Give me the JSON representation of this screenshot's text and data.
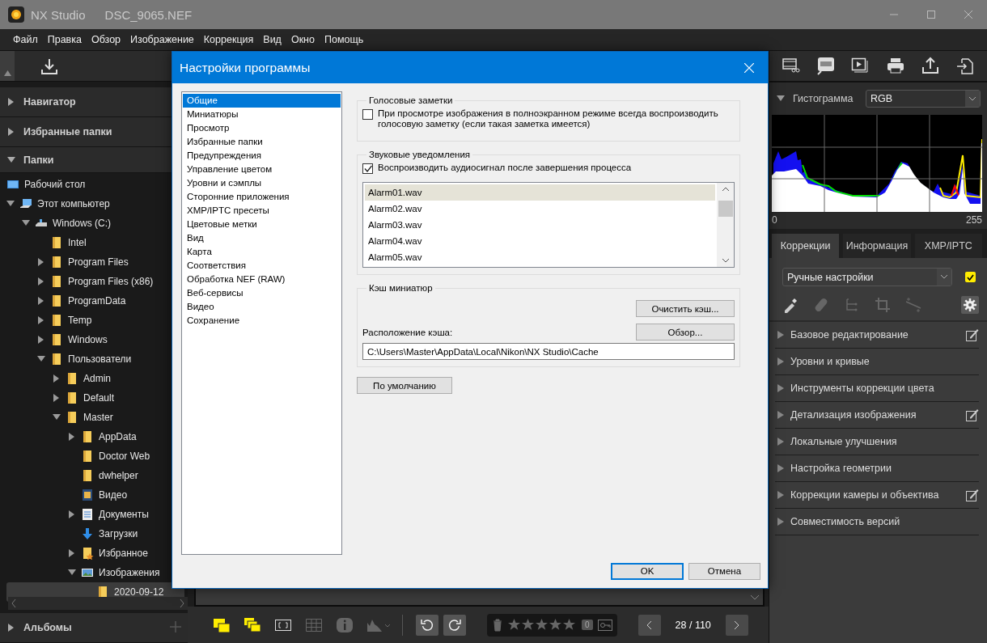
{
  "app_title": {
    "name": "NX Studio",
    "file": "DSC_9065.NEF"
  },
  "menu": [
    "Файл",
    "Правка",
    "Обзор",
    "Изображение",
    "Коррекция",
    "Вид",
    "Окно",
    "Помощь"
  ],
  "left_panel": {
    "sections": [
      {
        "label": "Навигатор",
        "expanded": false
      },
      {
        "label": "Избранные папки",
        "expanded": false
      },
      {
        "label": "Папки",
        "expanded": true
      }
    ],
    "tree": [
      {
        "label": "Рабочий стол",
        "kind": "desktop",
        "selected": false
      },
      {
        "label": "Этот компьютер",
        "kind": "computer",
        "expanded": true,
        "selected": false,
        "children": [
          {
            "label": "Windows (C:)",
            "kind": "drive",
            "expanded": true,
            "selected": false,
            "children": [
              {
                "label": "Intel",
                "kind": "folder",
                "selected": false
              },
              {
                "label": "Program Files",
                "kind": "folder",
                "expanded": false,
                "selected": false
              },
              {
                "label": "Program Files (x86)",
                "kind": "folder",
                "expanded": false,
                "selected": false
              },
              {
                "label": "ProgramData",
                "kind": "folder",
                "expanded": false,
                "selected": false
              },
              {
                "label": "Temp",
                "kind": "folder",
                "expanded": false,
                "selected": false
              },
              {
                "label": "Windows",
                "kind": "folder",
                "expanded": false,
                "selected": false
              },
              {
                "label": "Пользователи",
                "kind": "folder",
                "expanded": true,
                "selected": false,
                "children": [
                  {
                    "label": "Admin",
                    "kind": "folder",
                    "expanded": false,
                    "selected": false
                  },
                  {
                    "label": "Default",
                    "kind": "folder",
                    "expanded": false,
                    "selected": false
                  },
                  {
                    "label": "Master",
                    "kind": "folder",
                    "expanded": true,
                    "selected": false,
                    "children": [
                      {
                        "label": "AppData",
                        "kind": "folder",
                        "expanded": false,
                        "selected": false
                      },
                      {
                        "label": "Doctor Web",
                        "kind": "folder",
                        "selected": false
                      },
                      {
                        "label": "dwhelper",
                        "kind": "folder",
                        "selected": false
                      },
                      {
                        "label": "Видео",
                        "kind": "video",
                        "selected": false
                      },
                      {
                        "label": "Документы",
                        "kind": "documents",
                        "expanded": false,
                        "selected": false
                      },
                      {
                        "label": "Загрузки",
                        "kind": "downloads",
                        "selected": false
                      },
                      {
                        "label": "Избранное",
                        "kind": "favorites",
                        "expanded": false,
                        "selected": false
                      },
                      {
                        "label": "Изображения",
                        "kind": "pictures",
                        "expanded": true,
                        "selected": false,
                        "children": [
                          {
                            "label": "2020-09-12",
                            "kind": "folder",
                            "selected": true
                          }
                        ]
                      }
                    ]
                  }
                ]
              }
            ]
          }
        ]
      }
    ],
    "albums": {
      "label": "Альбомы",
      "expanded": false
    }
  },
  "bottom_toolbar": {
    "stars": 0,
    "rating_count": "0",
    "counter": "28 / 110"
  },
  "right_panel": {
    "histogram": {
      "label": "Гистограмма",
      "expanded": true,
      "channel": "RGB",
      "min_label": "0",
      "max_label": "255"
    },
    "tabs": [
      {
        "label": "Коррекции",
        "selected": true
      },
      {
        "label": "Информация",
        "selected": false
      },
      {
        "label": "XMP/IPTC",
        "selected": false
      }
    ],
    "preset": {
      "value": "Ручные настройки",
      "checked": true
    },
    "adjustments": [
      {
        "label": "Базовое редактирование",
        "edited": true
      },
      {
        "label": "Уровни и кривые",
        "edited": false
      },
      {
        "label": "Инструменты коррекции цвета",
        "edited": false
      },
      {
        "label": "Детализация изображения",
        "edited": true
      },
      {
        "label": "Локальные улучшения",
        "edited": false
      },
      {
        "label": "Настройка геометрии",
        "edited": false
      },
      {
        "label": "Коррекции камеры и объектива",
        "edited": true
      },
      {
        "label": "Совместимость версий",
        "edited": false
      }
    ]
  },
  "dialog": {
    "title": "Настройки программы",
    "categories": [
      {
        "label": "Общие",
        "selected": true
      },
      {
        "label": "Миниатюры",
        "selected": false
      },
      {
        "label": "Просмотр",
        "selected": false
      },
      {
        "label": "Избранные папки",
        "selected": false
      },
      {
        "label": "Предупреждения",
        "selected": false
      },
      {
        "label": "Управление цветом",
        "selected": false
      },
      {
        "label": "Уровни и сэмплы",
        "selected": false
      },
      {
        "label": "Сторонние приложения",
        "selected": false
      },
      {
        "label": "XMP/IPTC пресеты",
        "selected": false
      },
      {
        "label": "Цветовые метки",
        "selected": false
      },
      {
        "label": "Вид",
        "selected": false
      },
      {
        "label": "Карта",
        "selected": false
      },
      {
        "label": "Соответствия",
        "selected": false
      },
      {
        "label": "Обработка NEF (RAW)",
        "selected": false
      },
      {
        "label": "Веб-сервисы",
        "selected": false
      },
      {
        "label": "Видео",
        "selected": false
      },
      {
        "label": "Сохранение",
        "selected": false
      }
    ],
    "voice_group": {
      "title": "Голосовые заметки",
      "checkbox": {
        "label": "При просмотре изображения в полноэкранном режиме всегда воспроизводить голосовую заметку (если такая заметка имеется)",
        "checked": false
      }
    },
    "sound_group": {
      "title": "Звуковые уведомления",
      "checkbox": {
        "label": "Воспроизводить аудиосигнал после завершения процесса",
        "checked": true
      },
      "sounds": [
        {
          "label": "Alarm01.wav",
          "selected": true
        },
        {
          "label": "Alarm02.wav",
          "selected": false
        },
        {
          "label": "Alarm03.wav",
          "selected": false
        },
        {
          "label": "Alarm04.wav",
          "selected": false
        },
        {
          "label": "Alarm05.wav",
          "selected": false
        }
      ]
    },
    "cache_group": {
      "title": "Кэш миниатюр",
      "clear_button": "Очистить кэш...",
      "location_label": "Расположение кэша:",
      "browse_button": "Обзор...",
      "path": "C:\\Users\\Master\\AppData\\Local\\Nikon\\NX Studio\\Cache"
    },
    "default_button": "По умолчанию",
    "ok_button": "OK",
    "cancel_button": "Отмена"
  }
}
